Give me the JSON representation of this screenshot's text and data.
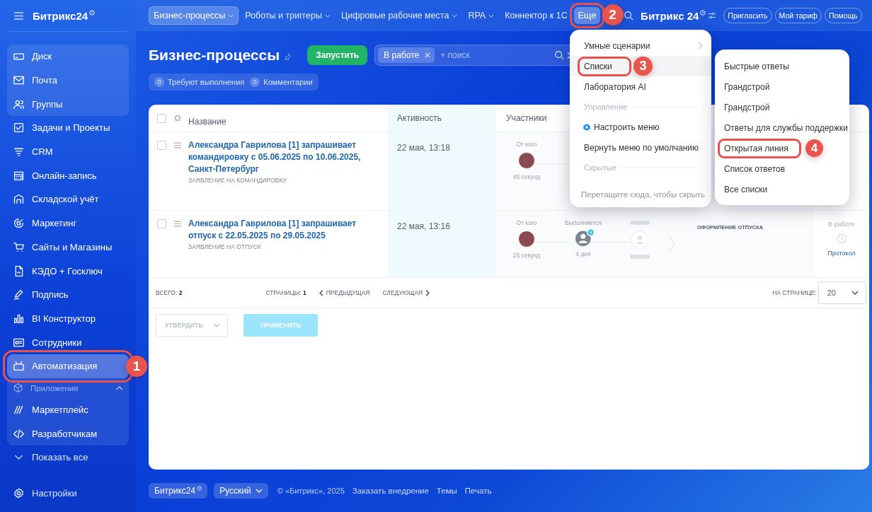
{
  "sidebar": {
    "logo": "Битрикс24",
    "groups": [
      {
        "kind": "panel",
        "items": [
          {
            "label": "Диск",
            "selected": false
          },
          {
            "label": "Почта",
            "selected": false
          },
          {
            "label": "Группы",
            "selected": false
          }
        ]
      },
      {
        "kind": "plain",
        "items": [
          {
            "label": "Задачи и Проекты",
            "selected": false
          },
          {
            "label": "CRM",
            "selected": false
          },
          {
            "label": "Онлайн-запись",
            "selected": false
          },
          {
            "label": "Складской учёт",
            "selected": false
          },
          {
            "label": "Маркетинг",
            "selected": false
          },
          {
            "label": "Сайты и Магазины",
            "selected": false
          },
          {
            "label": "КЭДО + Госключ",
            "selected": false
          },
          {
            "label": "Подпись",
            "selected": false
          },
          {
            "label": "BI Конструктор",
            "selected": false
          },
          {
            "label": "Сотрудники",
            "selected": false
          },
          {
            "label": "Автоматизация",
            "selected": true,
            "callout": "1"
          }
        ]
      },
      {
        "kind": "panel",
        "title": "Приложения",
        "expanded": true,
        "items": [
          {
            "label": "Маркетплейс",
            "selected": false
          },
          {
            "label": "Разработчикам",
            "selected": false
          }
        ]
      }
    ],
    "show_all": "Показать все",
    "settings": "Настройки"
  },
  "topbar": {
    "nav": [
      {
        "label": "Бизнес-процессы",
        "kind": "dropdown",
        "selected": true,
        "expanded": false
      },
      {
        "label": "Роботы и триггеры",
        "kind": "dropdown",
        "selected": false,
        "expanded": false
      },
      {
        "label": "Цифровые рабочие места",
        "kind": "dropdown",
        "selected": false,
        "expanded": false
      },
      {
        "label": "RPA",
        "kind": "dropdown",
        "selected": false,
        "expanded": false
      },
      {
        "label": "Коннектор к 1С",
        "kind": "link",
        "selected": false,
        "expanded": false
      },
      {
        "label": "Еще",
        "kind": "link",
        "selected": false,
        "expanded": true,
        "callout": "2"
      }
    ],
    "logo": "Битрикс 24",
    "buttons": [
      "Пригласить",
      "Мой тариф",
      "Помощь"
    ]
  },
  "page": {
    "title": "Бизнес-процессы",
    "start_button": "Запустить",
    "filter": {
      "tag": "В работе",
      "placeholder": "+ поиск"
    },
    "counters": [
      {
        "count": "0",
        "label": "Требуют выполнения"
      },
      {
        "count": "0",
        "label": "Комментарии"
      }
    ]
  },
  "table": {
    "select_all_checked": false,
    "columns": [
      "Название",
      "Активность",
      "Участники"
    ],
    "rows": [
      {
        "title": "Александра Гаврилова [1] запрашивает командировку с 05.06.2025 по 10.06.2025, Санкт-Петербург",
        "subtitle": "ЗАЯВЛЕНИЕ НА КОМАНДИРОВКУ",
        "activity": "22 мая, 13:18",
        "checked": false,
        "participants": [
          {
            "kind": "author",
            "label": "От кого",
            "time": "45 секунд"
          }
        ]
      },
      {
        "title": "Александра Гаврилова [1] запрашивает отпуск с 22.05.2025 по 29.05.2025",
        "subtitle": "ЗАЯВЛЕНИЕ НА ОТПУСК",
        "activity": "22 мая, 13:16",
        "checked": false,
        "participants": [
          {
            "kind": "author",
            "label": "От кого",
            "time": "25 секунд"
          },
          {
            "kind": "executor",
            "label": "Выполняется",
            "time": "4 дня"
          },
          {
            "kind": "pending"
          }
        ],
        "task": "ОФОРМЛЕНИЕ ОТПУСКА",
        "status": "В работе",
        "log_link": "Протокол"
      }
    ],
    "total_label": "ВСЕГО:",
    "total": "2",
    "pages_label": "СТРАНИЦЫ:",
    "page": "1",
    "prev": "ПРЕДЫДУЩАЯ",
    "next": "СЛЕДУЮЩАЯ",
    "per_page_label": "НА СТРАНИЦЕ:",
    "per_page": "20",
    "action_select": {
      "label": "УТВЕРДИТЬ",
      "disabled": true
    },
    "apply": {
      "label": "ПРИМЕНИТЬ",
      "disabled": true
    }
  },
  "more_menu": {
    "items": [
      {
        "kind": "item",
        "label": "Умные сценарии",
        "submenu": true,
        "selected": false
      },
      {
        "kind": "item",
        "label": "Списки",
        "submenu": true,
        "selected": true,
        "callout": "3"
      },
      {
        "kind": "item",
        "label": "Лаборатория AI",
        "submenu": false,
        "selected": false
      },
      {
        "kind": "section",
        "label": "Управление"
      },
      {
        "kind": "setting",
        "label": "Настроить меню"
      },
      {
        "kind": "item",
        "label": "Вернуть меню по умолчанию",
        "submenu": false,
        "selected": false
      },
      {
        "kind": "section",
        "label": "Скрытые"
      },
      {
        "kind": "hint",
        "label": "Перетащите сюда, чтобы скрыть"
      }
    ]
  },
  "submenu": {
    "items": [
      {
        "label": "Быстрые ответы"
      },
      {
        "label": "Грандстрой"
      },
      {
        "label": "Грандстрой"
      },
      {
        "label": "Ответы для службы поддержки"
      },
      {
        "label": "Открытая линия",
        "callout": "4"
      },
      {
        "label": "Список ответов"
      },
      {
        "label": "Все списки"
      }
    ]
  },
  "footer": {
    "brand": "Битрикс24",
    "language": "Русский",
    "copyright": "© «Битрикс», 2025",
    "links": [
      "Заказать внедрение",
      "Темы",
      "Печать"
    ]
  }
}
